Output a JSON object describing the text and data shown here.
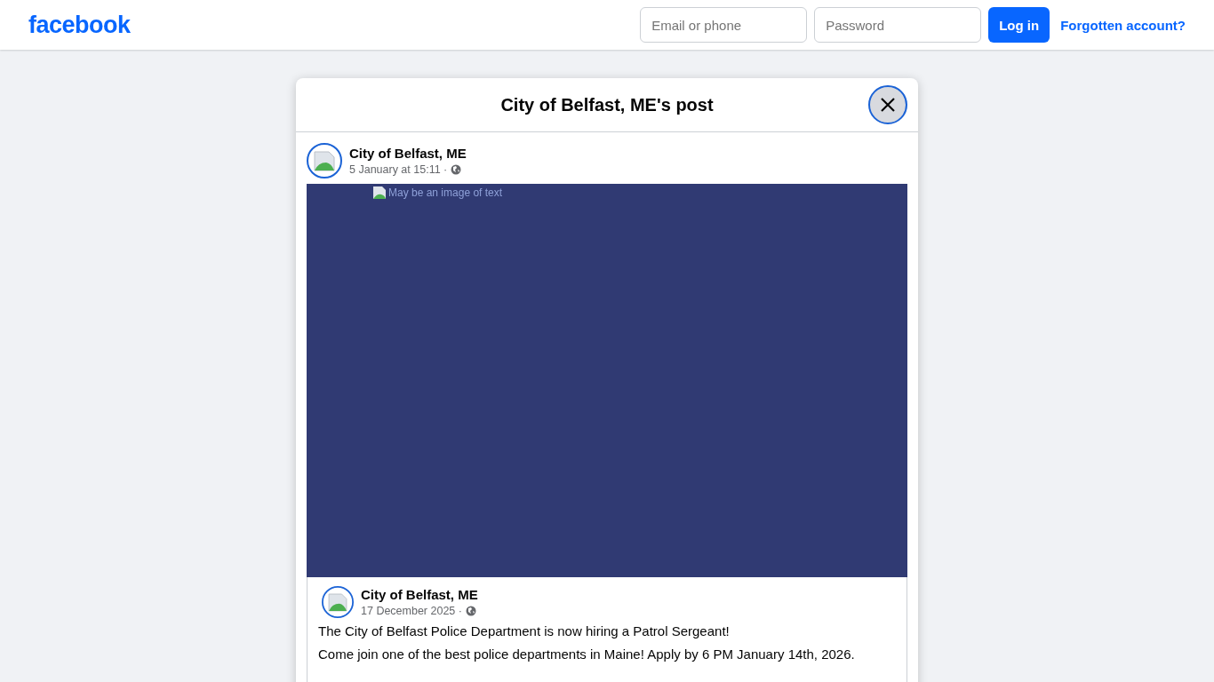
{
  "header": {
    "logo": "facebook",
    "email_field": {
      "placeholder": "Email or phone"
    },
    "password_field": {
      "placeholder": "Password"
    },
    "login_button": "Log in",
    "forgot_link": "Forgotten account?"
  },
  "dialog": {
    "title": "City of Belfast, ME's post",
    "post": {
      "author": "City of Belfast, ME",
      "time": "5 January at 15:11 ·",
      "image_alt": "May be an image of text",
      "shared_post": {
        "author": "City of Belfast, ME",
        "time": "17 December 2025 ·",
        "paragraphs": [
          "The City of Belfast Police Department is now hiring a Patrol Sergeant!",
          "Come join one of the best police departments in Maine! Apply by 6 PM January 14th, 2026."
        ]
      }
    }
  }
}
